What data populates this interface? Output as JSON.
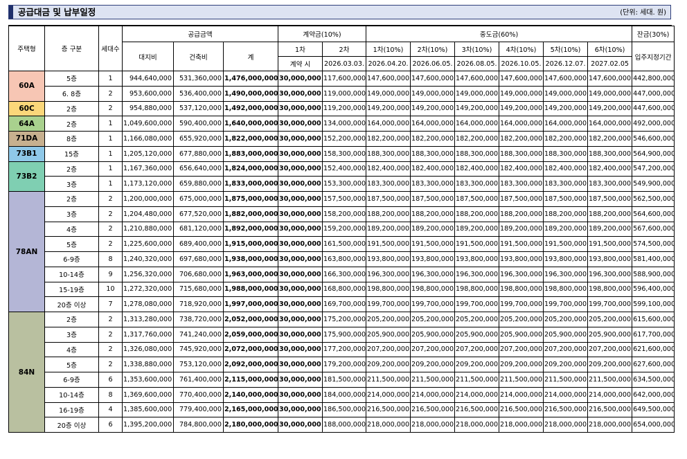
{
  "title": "공급대금 및 납부일정",
  "unit": "(단위: 세대. 원)",
  "headers": {
    "type": "주택형",
    "floor": "층 구분",
    "count": "세대수",
    "supply": "공급금액",
    "land": "대지비",
    "building": "건축비",
    "total": "계",
    "deposit": "계약금(10%)",
    "dep1": "1차",
    "dep2": "2차",
    "dep1_date": "계약 시",
    "dep2_date": "2026.03.03.",
    "middle": "중도금(60%)",
    "mid_labels": [
      "1차(10%)",
      "2차(10%)",
      "3차(10%)",
      "4차(10%)",
      "5차(10%)",
      "6차(10%)"
    ],
    "mid_dates": [
      "2026.04.20.",
      "2026.06.05.",
      "2026.08.05.",
      "2026.10.05.",
      "2026.12.07.",
      "2027.02.05"
    ],
    "balance": "잔금(30%)",
    "balance_date": "입주지정기간"
  },
  "colors": {
    "60A": "#f7c6b4",
    "60C": "#fbd77a",
    "64A": "#a9d18e",
    "71DA": "#c7b08f",
    "73B1": "#8fc8e8",
    "73B2": "#7fcfb2",
    "78AN": "#b4b6d6",
    "84N": "#b9c0a0"
  },
  "groups": [
    {
      "type": "60A",
      "rows": [
        {
          "floor": "5층",
          "count": "1",
          "land": "944,640,000",
          "building": "531,360,000",
          "total": "1,476,000,000",
          "dep1": "30,000,000",
          "dep2": "117,600,000",
          "mid": "147,600,000",
          "bal": "442,800,000"
        },
        {
          "floor": "6. 8층",
          "count": "2",
          "land": "953,600,000",
          "building": "536,400,000",
          "total": "1,490,000,000",
          "dep1": "30,000,000",
          "dep2": "119,000,000",
          "mid": "149,000,000",
          "bal": "447,000,000"
        }
      ]
    },
    {
      "type": "60C",
      "rows": [
        {
          "floor": "2층",
          "count": "2",
          "land": "954,880,000",
          "building": "537,120,000",
          "total": "1,492,000,000",
          "dep1": "30,000,000",
          "dep2": "119,200,000",
          "mid": "149,200,000",
          "bal": "447,600,000"
        }
      ]
    },
    {
      "type": "64A",
      "rows": [
        {
          "floor": "2층",
          "count": "1",
          "land": "1,049,600,000",
          "building": "590,400,000",
          "total": "1,640,000,000",
          "dep1": "30,000,000",
          "dep2": "134,000,000",
          "mid": "164,000,000",
          "bal": "492,000,000"
        }
      ]
    },
    {
      "type": "71DA",
      "rows": [
        {
          "floor": "8층",
          "count": "1",
          "land": "1,166,080,000",
          "building": "655,920,000",
          "total": "1,822,000,000",
          "dep1": "30,000,000",
          "dep2": "152,200,000",
          "mid": "182,200,000",
          "bal": "546,600,000"
        }
      ]
    },
    {
      "type": "73B1",
      "rows": [
        {
          "floor": "15층",
          "count": "1",
          "land": "1,205,120,000",
          "building": "677,880,000",
          "total": "1,883,000,000",
          "dep1": "30,000,000",
          "dep2": "158,300,000",
          "mid": "188,300,000",
          "bal": "564,900,000"
        }
      ]
    },
    {
      "type": "73B2",
      "rows": [
        {
          "floor": "2층",
          "count": "1",
          "land": "1,167,360,000",
          "building": "656,640,000",
          "total": "1,824,000,000",
          "dep1": "30,000,000",
          "dep2": "152,400,000",
          "mid": "182,400,000",
          "bal": "547,200,000"
        },
        {
          "floor": "3층",
          "count": "1",
          "land": "1,173,120,000",
          "building": "659,880,000",
          "total": "1,833,000,000",
          "dep1": "30,000,000",
          "dep2": "153,300,000",
          "mid": "183,300,000",
          "bal": "549,900,000"
        }
      ]
    },
    {
      "type": "78AN",
      "rows": [
        {
          "floor": "2층",
          "count": "2",
          "land": "1,200,000,000",
          "building": "675,000,000",
          "total": "1,875,000,000",
          "dep1": "30,000,000",
          "dep2": "157,500,000",
          "mid": "187,500,000",
          "bal": "562,500,000"
        },
        {
          "floor": "3층",
          "count": "2",
          "land": "1,204,480,000",
          "building": "677,520,000",
          "total": "1,882,000,000",
          "dep1": "30,000,000",
          "dep2": "158,200,000",
          "mid": "188,200,000",
          "bal": "564,600,000"
        },
        {
          "floor": "4층",
          "count": "2",
          "land": "1,210,880,000",
          "building": "681,120,000",
          "total": "1,892,000,000",
          "dep1": "30,000,000",
          "dep2": "159,200,000",
          "mid": "189,200,000",
          "bal": "567,600,000"
        },
        {
          "floor": "5층",
          "count": "2",
          "land": "1,225,600,000",
          "building": "689,400,000",
          "total": "1,915,000,000",
          "dep1": "30,000,000",
          "dep2": "161,500,000",
          "mid": "191,500,000",
          "bal": "574,500,000"
        },
        {
          "floor": "6-9층",
          "count": "8",
          "land": "1,240,320,000",
          "building": "697,680,000",
          "total": "1,938,000,000",
          "dep1": "30,000,000",
          "dep2": "163,800,000",
          "mid": "193,800,000",
          "bal": "581,400,000"
        },
        {
          "floor": "10-14층",
          "count": "9",
          "land": "1,256,320,000",
          "building": "706,680,000",
          "total": "1,963,000,000",
          "dep1": "30,000,000",
          "dep2": "166,300,000",
          "mid": "196,300,000",
          "bal": "588,900,000"
        },
        {
          "floor": "15-19층",
          "count": "10",
          "land": "1,272,320,000",
          "building": "715,680,000",
          "total": "1,988,000,000",
          "dep1": "30,000,000",
          "dep2": "168,800,000",
          "mid": "198,800,000",
          "bal": "596,400,000"
        },
        {
          "floor": "20층 이상",
          "count": "7",
          "land": "1,278,080,000",
          "building": "718,920,000",
          "total": "1,997,000,000",
          "dep1": "30,000,000",
          "dep2": "169,700,000",
          "mid": "199,700,000",
          "bal": "599,100,000"
        }
      ]
    },
    {
      "type": "84N",
      "rows": [
        {
          "floor": "2층",
          "count": "2",
          "land": "1,313,280,000",
          "building": "738,720,000",
          "total": "2,052,000,000",
          "dep1": "30,000,000",
          "dep2": "175,200,000",
          "mid": "205,200,000",
          "bal": "615,600,000"
        },
        {
          "floor": "3층",
          "count": "2",
          "land": "1,317,760,000",
          "building": "741,240,000",
          "total": "2,059,000,000",
          "dep1": "30,000,000",
          "dep2": "175,900,000",
          "mid": "205,900,000",
          "bal": "617,700,000"
        },
        {
          "floor": "4층",
          "count": "2",
          "land": "1,326,080,000",
          "building": "745,920,000",
          "total": "2,072,000,000",
          "dep1": "30,000,000",
          "dep2": "177,200,000",
          "mid": "207,200,000",
          "bal": "621,600,000"
        },
        {
          "floor": "5층",
          "count": "2",
          "land": "1,338,880,000",
          "building": "753,120,000",
          "total": "2,092,000,000",
          "dep1": "30,000,000",
          "dep2": "179,200,000",
          "mid": "209,200,000",
          "bal": "627,600,000"
        },
        {
          "floor": "6-9층",
          "count": "6",
          "land": "1,353,600,000",
          "building": "761,400,000",
          "total": "2,115,000,000",
          "dep1": "30,000,000",
          "dep2": "181,500,000",
          "mid": "211,500,000",
          "bal": "634,500,000"
        },
        {
          "floor": "10-14층",
          "count": "8",
          "land": "1,369,600,000",
          "building": "770,400,000",
          "total": "2,140,000,000",
          "dep1": "30,000,000",
          "dep2": "184,000,000",
          "mid": "214,000,000",
          "bal": "642,000,000"
        },
        {
          "floor": "16-19층",
          "count": "4",
          "land": "1,385,600,000",
          "building": "779,400,000",
          "total": "2,165,000,000",
          "dep1": "30,000,000",
          "dep2": "186,500,000",
          "mid": "216,500,000",
          "bal": "649,500,000"
        },
        {
          "floor": "20층 이상",
          "count": "6",
          "land": "1,395,200,000",
          "building": "784,800,000",
          "total": "2,180,000,000",
          "dep1": "30,000,000",
          "dep2": "188,000,000",
          "mid": "218,000,000",
          "bal": "654,000,000"
        }
      ]
    }
  ]
}
